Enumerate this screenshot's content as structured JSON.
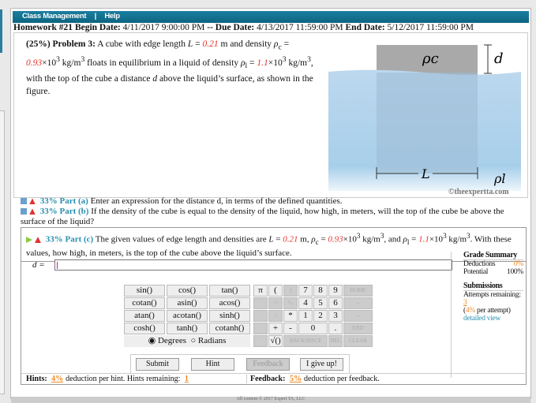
{
  "nav": {
    "items": [
      "Class Management",
      "Help"
    ],
    "sep": "|"
  },
  "homework": {
    "title": "Homework #21",
    "begin_label": "Begin Date:",
    "begin": "4/11/2017 9:00:00 PM",
    "due_label": "-- Due Date:",
    "due": "4/13/2017 11:59:00 PM",
    "end_label": "End Date:",
    "end": "5/12/2017 11:59:00 PM"
  },
  "problem": {
    "header": "(25%) Problem 3:",
    "t1": "A cube with edge length",
    "L": "0.21",
    "rho_c": "0.93",
    "rho_l": "1.1",
    "t2": "m and density",
    "t3": "floats in equilibrium in a liquid of density",
    "t4": "with the top of the cube a distance",
    "t5": "above the liquid’s surface, as shown in the figure."
  },
  "figure": {
    "rho_c": "ρc",
    "d": "d",
    "L": "L",
    "rho_l": "ρl",
    "credit": "©theexpertta.com"
  },
  "parts": [
    {
      "pct": "33% Part (a)",
      "text": "Enter an expression for the distance d, in terms of the defined quantities."
    },
    {
      "pct": "33% Part (b)",
      "text": "If the density of the cube is equal to the density of the liquid, how high, in meters, will the top of the cube be above the surface of the liquid?"
    },
    {
      "pct": "33% Part (c)",
      "text_a": "The given values of edge length and densities are",
      "text_b": "With these values, how high, in meters, is the top of the cube above the liquid’s surface."
    }
  ],
  "answer": {
    "label": "d =",
    "value": ""
  },
  "grade": {
    "title": "Grade Summary",
    "deductions_label": "Deductions",
    "deductions": "0%",
    "potential_label": "Potential",
    "potential": "100%",
    "sub_title": "Submissions",
    "attempts_label": "Attempts remaining:",
    "attempts": "3",
    "per_attempt": "4%",
    "per_attempt_suffix": "per attempt)",
    "detailed": "detailed view"
  },
  "keypad": {
    "functions": [
      "sin()",
      "cos()",
      "tan()",
      "cotan()",
      "asin()",
      "acos()",
      "atan()",
      "acotan()",
      "sinh()",
      "cosh()",
      "tanh()",
      "cotanh()"
    ],
    "keys": [
      "π",
      "(",
      ")",
      "7",
      "8",
      "9",
      "HOME",
      "↑^",
      "^↓",
      "4",
      "5",
      "6",
      "←",
      "/",
      "*",
      "1",
      "2",
      "3",
      "→",
      "+",
      "-",
      "0",
      ".",
      "END",
      "√()",
      "BACKSPACE",
      "DEL",
      "CLEAR"
    ],
    "degrees": "Degrees",
    "radians": "Radians"
  },
  "buttons": {
    "submit": "Submit",
    "hint": "Hint",
    "feedback": "Feedback",
    "giveup": "I give up!"
  },
  "hints": {
    "label": "Hints:",
    "pct": "4%",
    "text": "deduction per hint. Hints remaining:",
    "remaining": "1"
  },
  "feedback": {
    "label": "Feedback:",
    "pct": "5%",
    "text": "deduction per feedback."
  },
  "footer": "All content © 2017 Expert TA, LLC",
  "colors": {
    "accent": "#1a7fa0",
    "value_red": "#e8342c",
    "orange": "#f08a24"
  }
}
